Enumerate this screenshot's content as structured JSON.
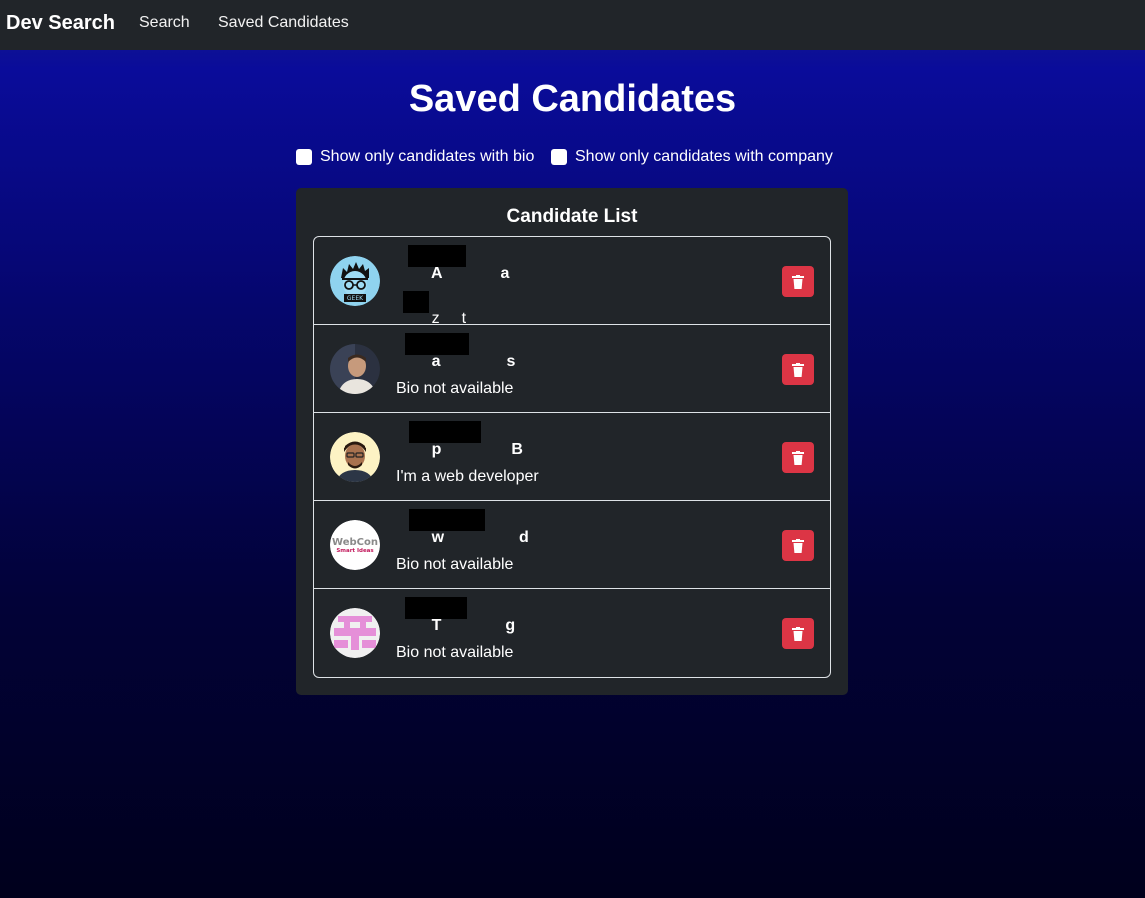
{
  "navbar": {
    "brand": "Dev Search",
    "links": [
      "Search",
      "Saved Candidates"
    ]
  },
  "page": {
    "title": "Saved Candidates",
    "filters": {
      "bio_label": "Show only candidates with bio",
      "company_label": "Show only candidates with company"
    }
  },
  "panel": {
    "title": "Candidate List",
    "candidates": [
      {
        "name_start": "A",
        "name_end": "a",
        "bio_start": "z",
        "bio_end": "t",
        "avatar": "geek-avatar"
      },
      {
        "name_start": "a",
        "name_end": "s",
        "bio": "Bio not available",
        "avatar": "photo-avatar"
      },
      {
        "name_start": "p",
        "name_end": "B",
        "bio": "I'm a web developer",
        "avatar": "photo-avatar"
      },
      {
        "name_start": "w",
        "name_end": "d",
        "bio": "Bio not available",
        "avatar": "webcon-logo"
      },
      {
        "name_start": "T",
        "name_end": "g",
        "bio": "Bio not available",
        "avatar": "pixel-avatar"
      }
    ]
  },
  "colors": {
    "navbar": "#212529",
    "panel": "#212529",
    "delete_button": "#dc3545"
  },
  "avatars": {
    "webcon_text_1": "WebCon",
    "webcon_text_2": "Smart Ideas",
    "geek_text": "GEEK"
  }
}
